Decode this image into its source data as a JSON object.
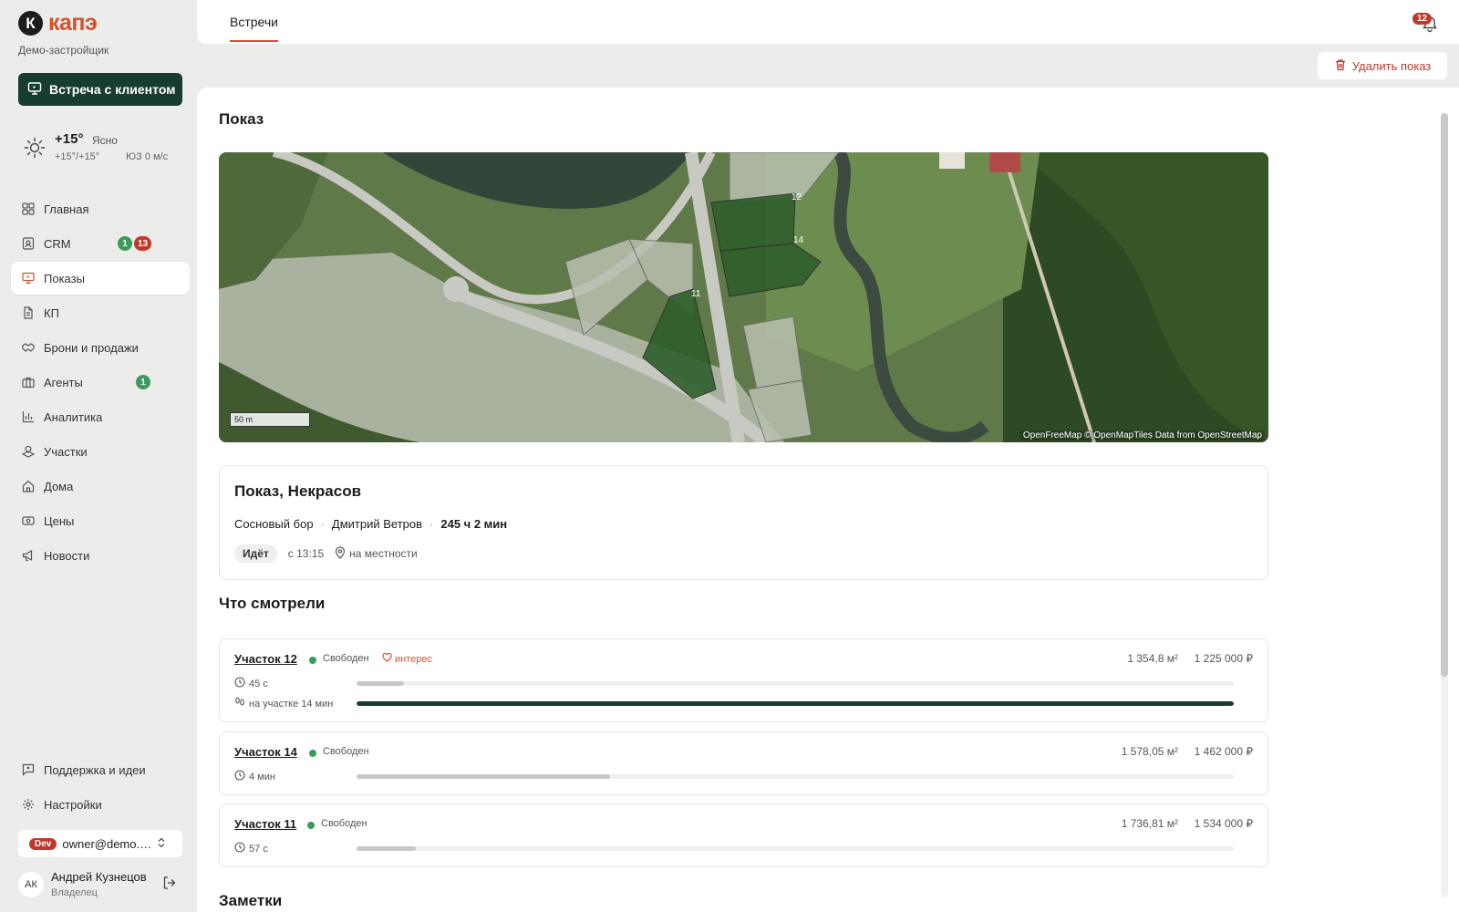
{
  "brand": {
    "logo_letter": "К",
    "name": "капэ",
    "company": "Демо-застройщик"
  },
  "meet_button": {
    "label": "Встреча с клиентом",
    "icon": "presentation-icon"
  },
  "weather": {
    "temp": "+15°",
    "condition": "Ясно",
    "range": "+15°/+15°",
    "wind": "ЮЗ 0 м/с",
    "icon": "sun-icon"
  },
  "nav": {
    "items": [
      {
        "label": "Главная",
        "icon": "grid-icon"
      },
      {
        "label": "CRM",
        "icon": "contact-icon",
        "badge_green": "1",
        "badge_red": "13"
      },
      {
        "label": "Показы",
        "icon": "presentation-icon",
        "active": true
      },
      {
        "label": "КП",
        "icon": "document-icon"
      },
      {
        "label": "Брони и продажи",
        "icon": "handshake-icon"
      },
      {
        "label": "Агенты",
        "icon": "briefcase-icon",
        "badge_green": "1"
      },
      {
        "label": "Аналитика",
        "icon": "bar-chart-icon"
      },
      {
        "label": "Участки",
        "icon": "plots-icon"
      },
      {
        "label": "Дома",
        "icon": "home-icon"
      },
      {
        "label": "Цены",
        "icon": "price-icon"
      },
      {
        "label": "Новости",
        "icon": "megaphone-icon"
      }
    ],
    "bottom": [
      {
        "label": "Поддержка и идеи",
        "icon": "message-icon"
      },
      {
        "label": "Настройки",
        "icon": "gear-icon"
      }
    ]
  },
  "account": {
    "env": "Dev",
    "email": "owner@demo.kape.ru"
  },
  "user": {
    "initials": "АК",
    "name": "Андрей Кузнецов",
    "role": "Владелец"
  },
  "topbar": {
    "tab": "Встречи",
    "notifications": "12"
  },
  "delete_button": {
    "label": "Удалить показ"
  },
  "page": {
    "section_title": "Показ",
    "map": {
      "scale": "50 m",
      "attribution": "OpenFreeMap © OpenMapTiles Data from OpenStreetMap",
      "plot_labels": [
        "12",
        "14",
        "11"
      ]
    },
    "showing": {
      "title": "Показ, Некрасов",
      "project": "Сосновый бор",
      "agent": "Дмитрий Ветров",
      "duration": "245 ч 2 мин",
      "status": "Идёт",
      "since": "с 13:15",
      "location": "на местности"
    },
    "watched_title": "Что смотрели",
    "plots": [
      {
        "name": "Участок 12",
        "status": "Свободен",
        "interest": "интерес",
        "area": "1 354,8 м²",
        "price": "1 225 000 ₽",
        "time": "45 с",
        "time_fraction": 0.054,
        "onsite": "на участке 14 мин",
        "onsite_fraction": 1.0
      },
      {
        "name": "Участок 14",
        "status": "Свободен",
        "area": "1 578,05 м²",
        "price": "1 462 000 ₽",
        "time": "4 мин",
        "time_fraction": 0.289
      },
      {
        "name": "Участок 11",
        "status": "Свободен",
        "area": "1 736,81 м²",
        "price": "1 534 000 ₽",
        "time": "57 с",
        "time_fraction": 0.068
      }
    ],
    "notes_title": "Заметки"
  }
}
